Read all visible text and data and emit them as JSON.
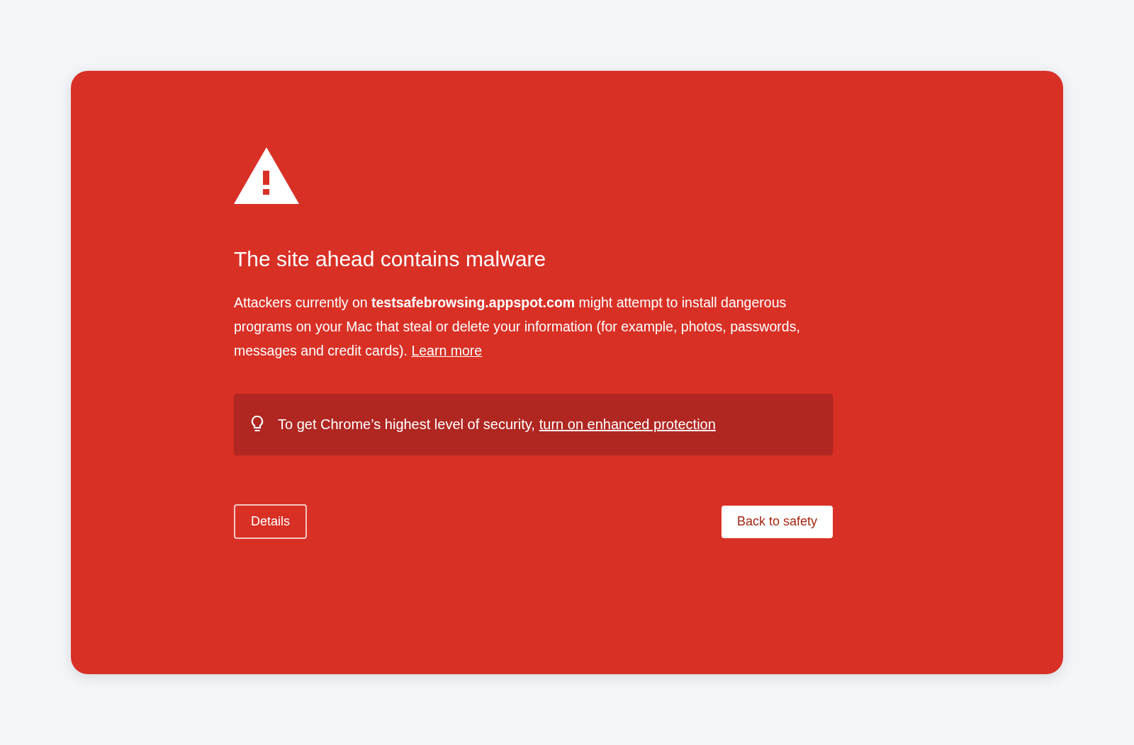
{
  "warning": {
    "title": "The site ahead contains malware",
    "message": {
      "text": "Attackers currently on **testsafebrowsing.appspot.com** might attempt to install dangerous programs on your Mac that steal or delete your information (for example, photos, passwords, messages and credit cards).",
      "link": "Learn more"
    },
    "tip": {
      "text": "To get Chrome’s highest level of security,",
      "link": "turn on enhanced protection"
    },
    "buttons": [
      {
        "label": "Details",
        "kind": "outline"
      },
      {
        "label": "Back to safety",
        "kind": "primary"
      }
    ]
  }
}
